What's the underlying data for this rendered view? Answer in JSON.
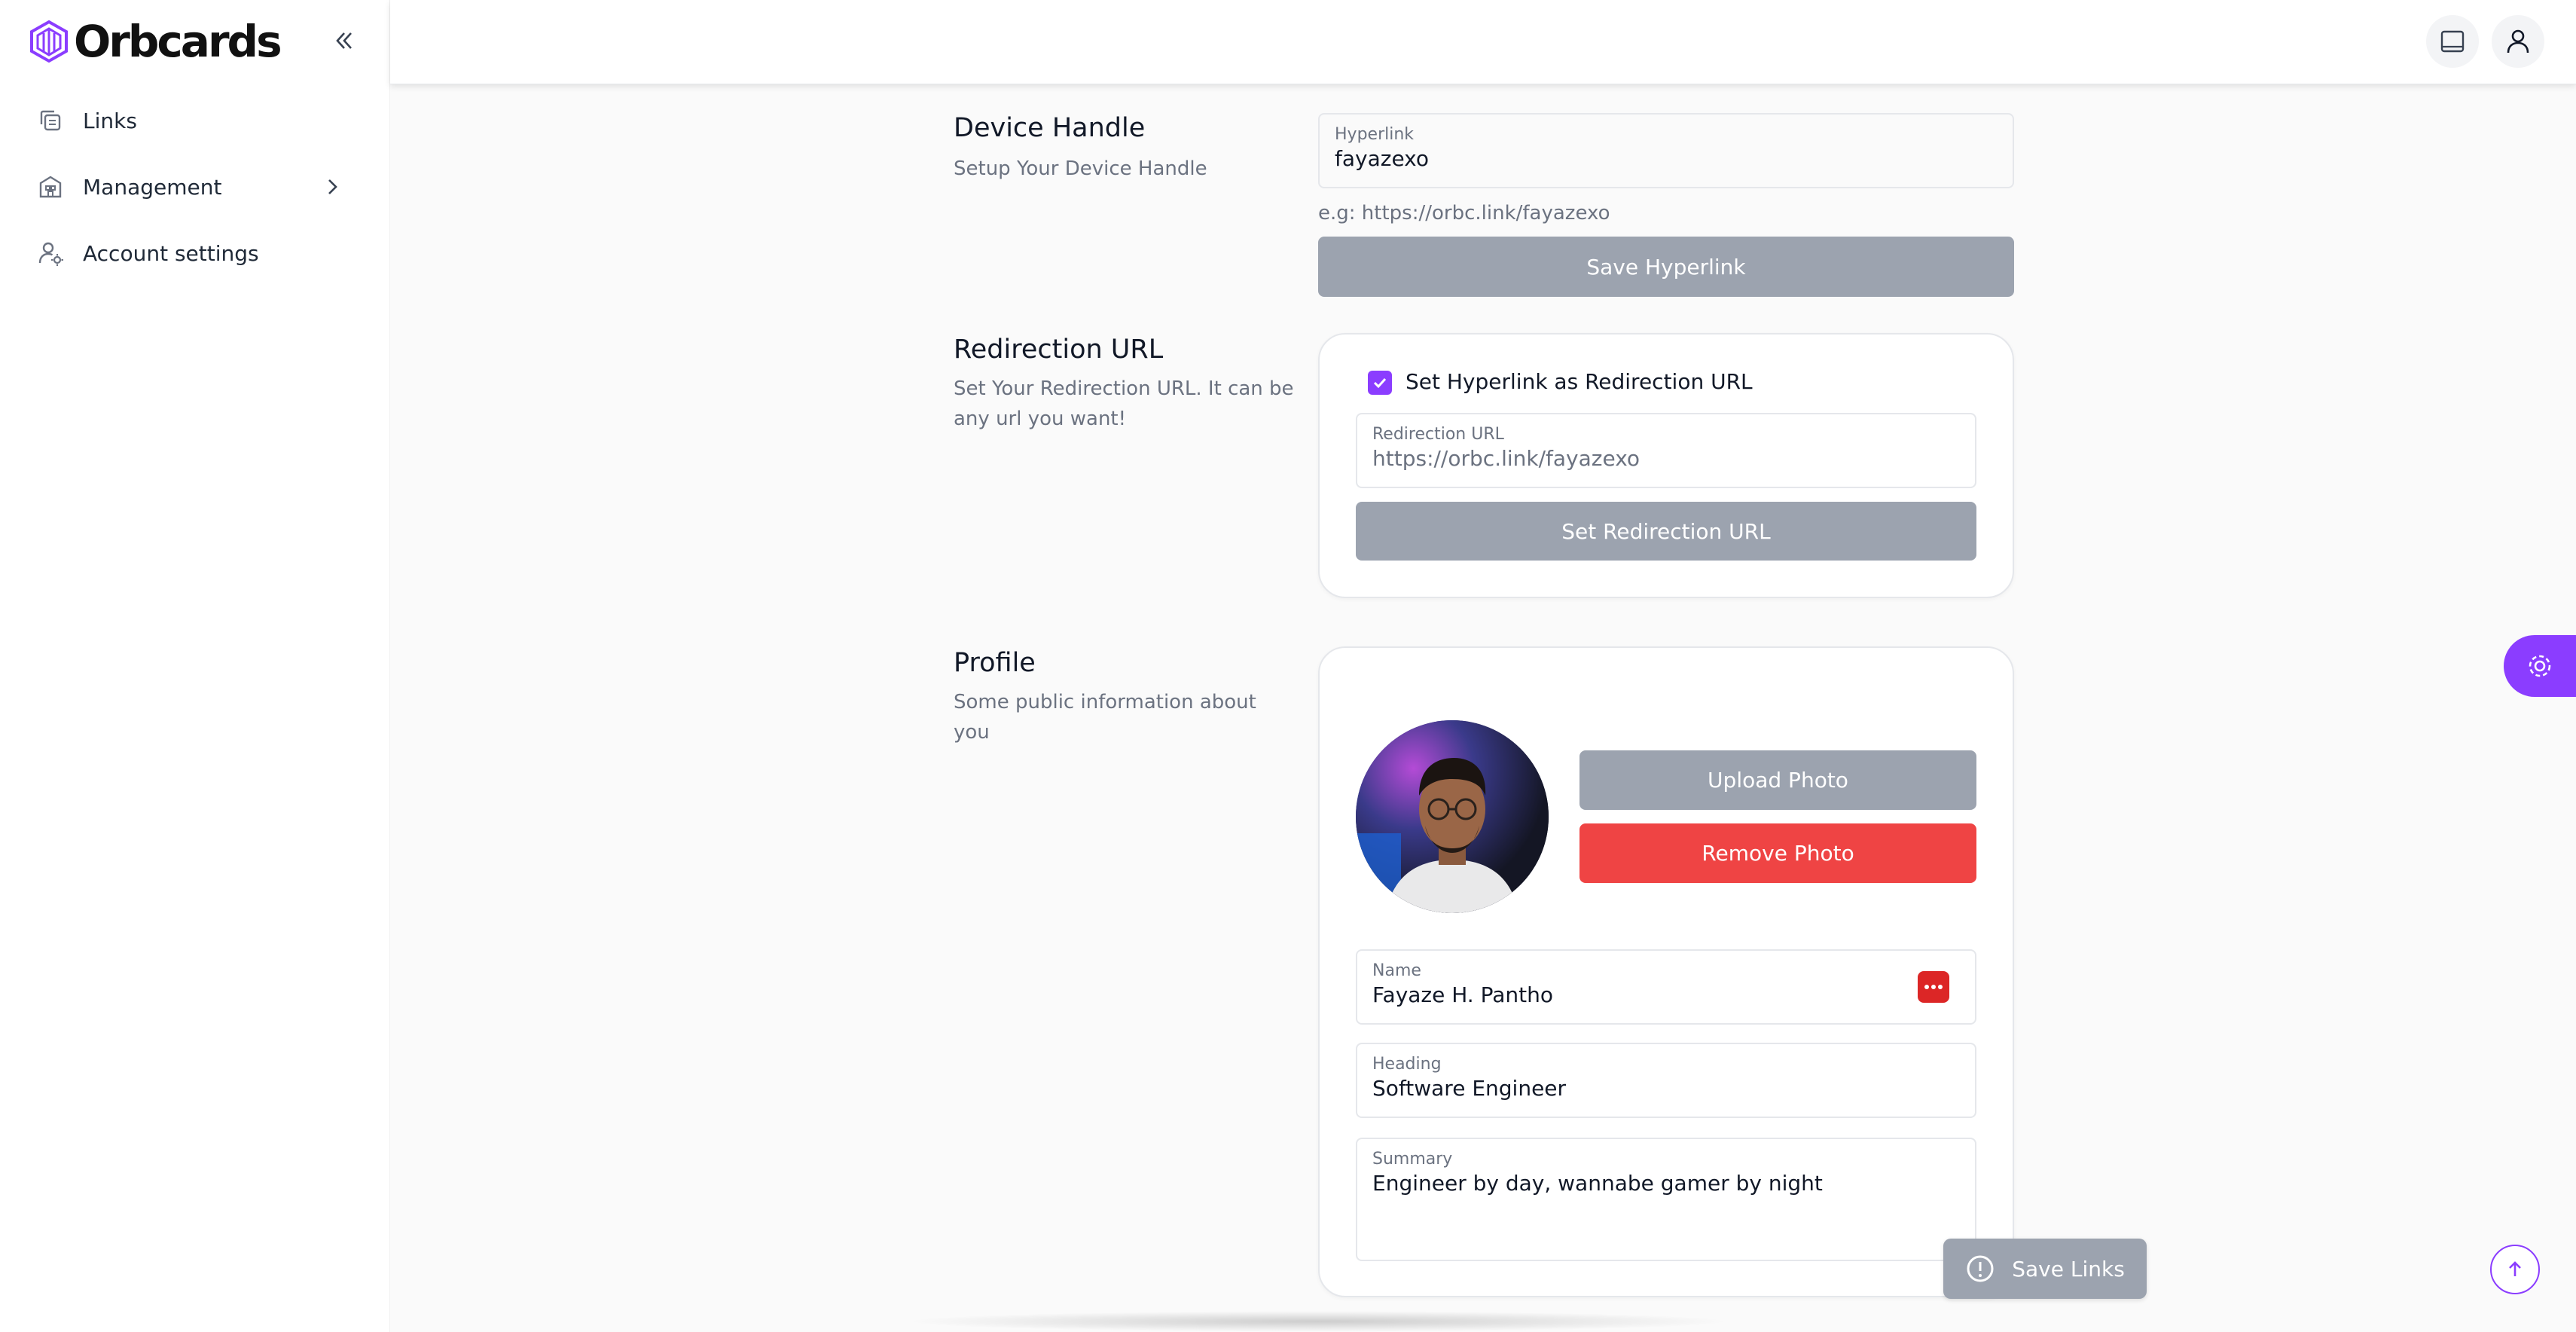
{
  "brand": {
    "name": "Orbcards",
    "accent": "#8b3dff"
  },
  "sidebar": {
    "collapse_icon": "double-chevron-left-icon",
    "items": [
      {
        "label": "Links",
        "icon": "copy-icon"
      },
      {
        "label": "Management",
        "icon": "building-icon",
        "has_submenu": true
      },
      {
        "label": "Account settings",
        "icon": "user-gear-icon"
      }
    ]
  },
  "topbar": {
    "icons": [
      "tablet-icon",
      "user-icon"
    ]
  },
  "device_handle": {
    "title": "Device Handle",
    "description": "Setup Your Device Handle",
    "field_label": "Hyperlink",
    "field_value": "fayazexo",
    "hint": "e.g: https://orbc.link/fayazexo",
    "save_label": "Save Hyperlink"
  },
  "redirection": {
    "title": "Redirection URL",
    "description": "Set Your Redirection URL. It can be any url you want!",
    "checkbox_label": "Set Hyperlink as Redirection URL",
    "checkbox_checked": true,
    "field_label": "Redirection URL",
    "field_value": "https://orbc.link/fayazexo",
    "button_label": "Set Redirection URL"
  },
  "profile": {
    "title": "Profile",
    "description": "Some public information about you",
    "upload_label": "Upload Photo",
    "remove_label": "Remove Photo",
    "name_label": "Name",
    "name_value": "Fayaze H. Pantho",
    "heading_label": "Heading",
    "heading_value": "Software Engineer",
    "summary_label": "Summary",
    "summary_value": "Engineer by day, wannabe gamer by night"
  },
  "footer": {
    "save_links_label": "Save Links"
  },
  "colors": {
    "grey_button": "#9ca3af",
    "danger": "#ef4444",
    "accent": "#8b3dff"
  }
}
